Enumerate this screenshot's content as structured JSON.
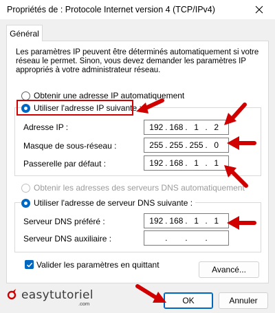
{
  "window": {
    "title": "Propriétés de : Protocole Internet version 4 (TCP/IPv4)"
  },
  "tabs": [
    {
      "label": "Général"
    }
  ],
  "description": {
    "lines": [
      "Les paramètres IP peuvent être déterminés automatiquement si votre",
      "réseau le permet. Sinon, vous devez demander les paramètres IP",
      "appropriés à votre administrateur réseau."
    ]
  },
  "ip_section": {
    "auto_label": "Obtenir une adresse IP automatiquement",
    "manual_label": "Utiliser l'adresse IP suivante :",
    "selected": "manual",
    "fields": [
      {
        "label": "Adresse IP :",
        "octets": [
          "192",
          "168",
          "1",
          "2"
        ]
      },
      {
        "label": "Masque de sous-réseau :",
        "octets": [
          "255",
          "255",
          "255",
          "0"
        ]
      },
      {
        "label": "Passerelle par défaut :",
        "octets": [
          "192",
          "168",
          "1",
          "1"
        ]
      }
    ]
  },
  "dns_section": {
    "auto_label": "Obtenir les adresses des serveurs DNS automatiquement",
    "manual_label": "Utiliser l'adresse de serveur DNS suivante :",
    "selected": "manual",
    "fields": [
      {
        "label": "Serveur DNS préféré :",
        "octets": [
          "192",
          "168",
          "1",
          "1"
        ]
      },
      {
        "label": "Serveur DNS auxiliaire :",
        "octets": [
          "",
          "",
          "",
          ""
        ]
      }
    ]
  },
  "validate": {
    "label": "Valider les paramètres en quittant",
    "checked": true
  },
  "buttons": {
    "advanced": "Avancé...",
    "ok": "OK",
    "cancel": "Annuler"
  },
  "watermark": {
    "brand": "easytutoriel",
    "suffix": ".com"
  },
  "colors": {
    "accent": "#0067c0",
    "annotation_red": "#d00000"
  },
  "icons": {
    "close": "close-icon",
    "checkmark": "checkmark-icon",
    "arrow": "red-arrow-icon"
  }
}
